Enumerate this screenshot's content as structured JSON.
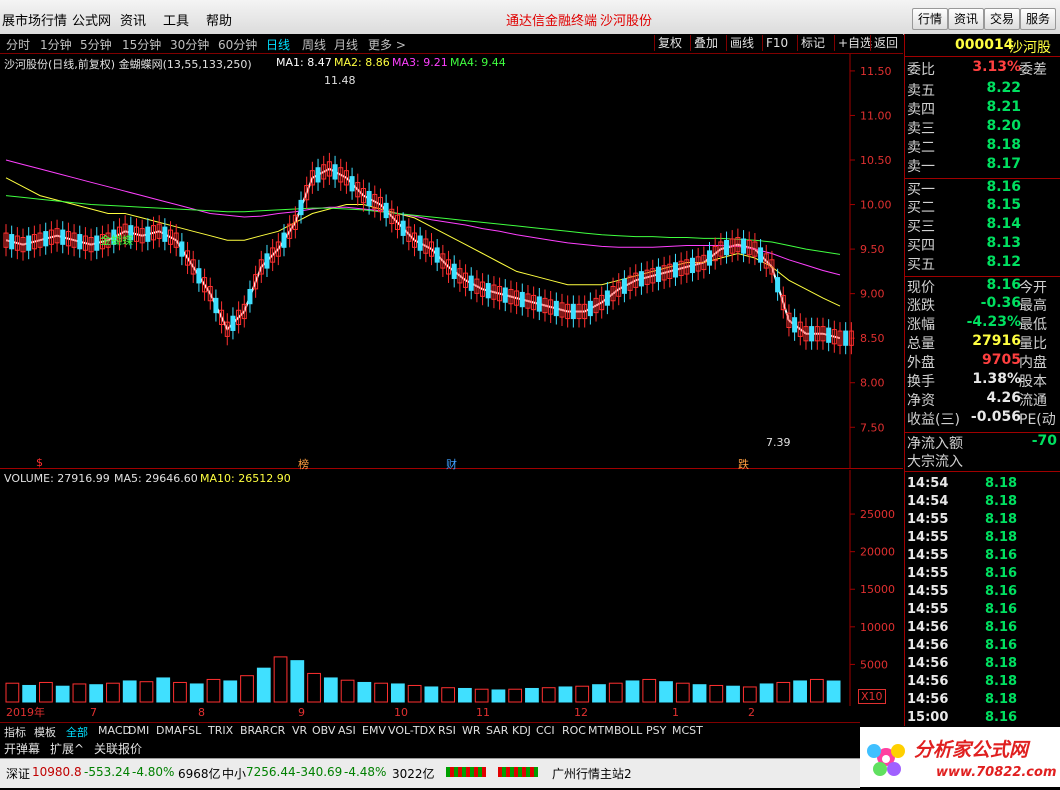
{
  "menu": {
    "items": [
      "展市场行情",
      "公式网",
      "资讯",
      "工具",
      "帮助"
    ],
    "title_left": "通达信金融终端",
    "title_right": "沙河股份",
    "right_buttons": [
      "行情",
      "资讯",
      "交易",
      "服务"
    ]
  },
  "periods": [
    "分时",
    "1分钟",
    "5分钟",
    "15分钟",
    "30分钟",
    "60分钟",
    "日线",
    "周线",
    "月线",
    "更多 >"
  ],
  "active_period": "日线",
  "tools": [
    "复权",
    "叠加",
    "画线",
    "F10",
    "标记",
    "+自选",
    "返回"
  ],
  "kchart": {
    "title": "沙河股份(日线,前复权) 金蝴蝶网(13,55,133,250)",
    "ma1": "MA1: 8.47",
    "ma2": "MA2: 8.86",
    "ma3": "MA3: 9.21",
    "ma4": "MA4: 9.44",
    "high_label": "11.48",
    "low_label": "7.39",
    "inline_label": "金蝴蝶",
    "markers": [
      "$",
      "榜",
      "财",
      "跌"
    ],
    "colors": {
      "ma1": "#ffffff",
      "ma2": "#ffff40",
      "ma3": "#ff40ff",
      "ma4": "#40ff40",
      "up": "#ff3030",
      "down": "#40e0ff",
      "trend": "#2020ff"
    }
  },
  "chart_data": [
    {
      "type": "line",
      "title": "",
      "ylim": [
        7.2,
        11.6
      ],
      "y_ticks": [
        "11.50",
        "11.00",
        "10.50",
        "10.00",
        "9.50",
        "9.00",
        "8.50",
        "8.00",
        "7.50"
      ],
      "x_ticks": [
        "2019年",
        "7",
        "8",
        "9",
        "10",
        "11",
        "12",
        "1",
        "2"
      ],
      "series": [
        {
          "name": "MA1",
          "values": [
            9.6,
            9.55,
            9.6,
            9.65,
            9.6,
            9.55,
            9.6,
            9.7,
            9.65,
            9.7,
            9.6,
            9.3,
            9.0,
            8.6,
            8.8,
            9.3,
            9.5,
            9.8,
            10.3,
            10.4,
            10.3,
            10.1,
            10.0,
            9.8,
            9.6,
            9.5,
            9.3,
            9.15,
            9.05,
            9.0,
            8.95,
            8.9,
            8.85,
            8.8,
            8.8,
            8.9,
            9.05,
            9.15,
            9.2,
            9.25,
            9.3,
            9.35,
            9.5,
            9.55,
            9.5,
            9.3,
            8.7,
            8.55,
            8.55,
            8.5
          ]
        },
        {
          "name": "MA2",
          "values": [
            10.3,
            10.2,
            10.1,
            10.05,
            10.0,
            9.95,
            9.9,
            9.9,
            9.85,
            9.8,
            9.75,
            9.7,
            9.65,
            9.6,
            9.6,
            9.65,
            9.7,
            9.8,
            9.9,
            9.95,
            10.0,
            10.0,
            9.95,
            9.9,
            9.85,
            9.75,
            9.65,
            9.55,
            9.45,
            9.35,
            9.25,
            9.2,
            9.15,
            9.1,
            9.1,
            9.1,
            9.15,
            9.2,
            9.25,
            9.3,
            9.35,
            9.35,
            9.4,
            9.45,
            9.4,
            9.3,
            9.15,
            9.05,
            8.95,
            8.86
          ]
        },
        {
          "name": "MA3",
          "values": [
            10.5,
            10.45,
            10.4,
            10.35,
            10.3,
            10.25,
            10.2,
            10.15,
            10.1,
            10.05,
            10.0,
            9.95,
            9.9,
            9.88,
            9.86,
            9.87,
            9.9,
            9.92,
            9.95,
            9.97,
            9.97,
            9.95,
            9.93,
            9.9,
            9.87,
            9.83,
            9.8,
            9.77,
            9.73,
            9.7,
            9.66,
            9.63,
            9.6,
            9.57,
            9.55,
            9.53,
            9.52,
            9.52,
            9.52,
            9.53,
            9.54,
            9.54,
            9.54,
            9.53,
            9.5,
            9.45,
            9.38,
            9.32,
            9.26,
            9.21
          ]
        },
        {
          "name": "MA4",
          "values": [
            10.1,
            10.08,
            10.06,
            10.04,
            10.02,
            10.0,
            9.99,
            9.98,
            9.97,
            9.96,
            9.95,
            9.94,
            9.93,
            9.92,
            9.92,
            9.93,
            9.94,
            9.95,
            9.96,
            9.96,
            9.95,
            9.94,
            9.92,
            9.9,
            9.88,
            9.86,
            9.84,
            9.82,
            9.8,
            9.78,
            9.76,
            9.74,
            9.72,
            9.7,
            9.68,
            9.66,
            9.65,
            9.64,
            9.64,
            9.63,
            9.63,
            9.62,
            9.62,
            9.61,
            9.6,
            9.58,
            9.54,
            9.5,
            9.47,
            9.44
          ]
        }
      ]
    },
    {
      "type": "bar",
      "title": "VOLUME: 27916.99",
      "ma5_label": "MA5: 29646.60",
      "ma10_label": "MA10: 26512.90",
      "y_ticks": [
        "25000",
        "20000",
        "15000",
        "10000",
        "5000"
      ],
      "multiplier": "X10",
      "ylim": [
        0,
        29000
      ],
      "values": [
        2500,
        2200,
        2600,
        2100,
        2400,
        2300,
        2500,
        2800,
        2700,
        3200,
        2600,
        2400,
        3000,
        2800,
        3500,
        4500,
        6000,
        5500,
        3800,
        3200,
        2900,
        2600,
        2500,
        2400,
        2200,
        2000,
        1900,
        1800,
        1700,
        1600,
        1700,
        1800,
        1900,
        2000,
        2100,
        2300,
        2500,
        2800,
        3000,
        2700,
        2500,
        2300,
        2200,
        2100,
        2000,
        2400,
        2600,
        2800,
        3000,
        2792
      ]
    }
  ],
  "side": {
    "code": "000014",
    "name": "沙河股",
    "weibi_label": "委比",
    "weibi": "3.13%",
    "weicha_label": "委差",
    "asks": [
      {
        "label": "卖五",
        "price": "8.22"
      },
      {
        "label": "卖四",
        "price": "8.21"
      },
      {
        "label": "卖三",
        "price": "8.20"
      },
      {
        "label": "卖二",
        "price": "8.18"
      },
      {
        "label": "卖一",
        "price": "8.17"
      }
    ],
    "bids": [
      {
        "label": "买一",
        "price": "8.16"
      },
      {
        "label": "买二",
        "price": "8.15"
      },
      {
        "label": "买三",
        "price": "8.14"
      },
      {
        "label": "买四",
        "price": "8.13"
      },
      {
        "label": "买五",
        "price": "8.12"
      }
    ],
    "stats": [
      {
        "label": "现价",
        "value": "8.16",
        "label2": "今开",
        "color": "#00e060"
      },
      {
        "label": "涨跌",
        "value": "-0.36",
        "label2": "最高",
        "color": "#00e060"
      },
      {
        "label": "涨幅",
        "value": "-4.23%",
        "label2": "最低",
        "color": "#00e060"
      },
      {
        "label": "总量",
        "value": "27916",
        "label2": "量比",
        "color": "#ffff40"
      },
      {
        "label": "外盘",
        "value": "9705",
        "label2": "内盘",
        "color": "#ff4040"
      },
      {
        "label": "换手",
        "value": "1.38%",
        "label2": "股本",
        "color": "#e8e8e8"
      },
      {
        "label": "净资",
        "value": "4.26",
        "label2": "流通",
        "color": "#e8e8e8"
      },
      {
        "label": "收益(三)",
        "value": "-0.056",
        "label2": "PE(动",
        "color": "#e8e8e8"
      }
    ],
    "netflow_label": "净流入额",
    "netflow": "-70",
    "bigflow_label": "大宗流入",
    "ticks": [
      {
        "time": "14:54",
        "price": "8.18"
      },
      {
        "time": "14:54",
        "price": "8.18"
      },
      {
        "time": "14:55",
        "price": "8.18"
      },
      {
        "time": "14:55",
        "price": "8.18"
      },
      {
        "time": "14:55",
        "price": "8.16"
      },
      {
        "time": "14:55",
        "price": "8.16"
      },
      {
        "time": "14:55",
        "price": "8.16"
      },
      {
        "time": "14:55",
        "price": "8.16"
      },
      {
        "time": "14:56",
        "price": "8.16"
      },
      {
        "time": "14:56",
        "price": "8.16"
      },
      {
        "time": "14:56",
        "price": "8.18"
      },
      {
        "time": "14:56",
        "price": "8.18"
      },
      {
        "time": "14:56",
        "price": "8.18"
      },
      {
        "time": "15:00",
        "price": "8.16"
      }
    ]
  },
  "indicators": [
    "指标",
    "模板",
    "全部",
    "MACD",
    "DMI",
    "DMA",
    "FSL",
    "TRIX",
    "BRAR",
    "CR",
    "VR",
    "OBV",
    "ASI",
    "EMV",
    "VOL-TDX",
    "RSI",
    "WR",
    "SAR",
    "KDJ",
    "CCI",
    "ROC",
    "MTM",
    "BOLL",
    "PSY",
    "MCST"
  ],
  "active_indicator": "全部",
  "subtabs": [
    "开弹幕",
    "扩展^",
    "关联报价"
  ],
  "status": {
    "sz_label": "深证",
    "sz_value": "10980.8",
    "sz_change": "-553.24",
    "sz_pct": "-4.80%",
    "sz_amount": "6968亿",
    "zx_label": "中小",
    "zx_value": "7256.44",
    "zx_change": "-340.69",
    "zx_pct": "-4.48%",
    "zx_amount": "3022亿",
    "server": "广州行情主站2"
  },
  "logo": {
    "text": "分析家公式网",
    "url": "www.70822.com"
  }
}
